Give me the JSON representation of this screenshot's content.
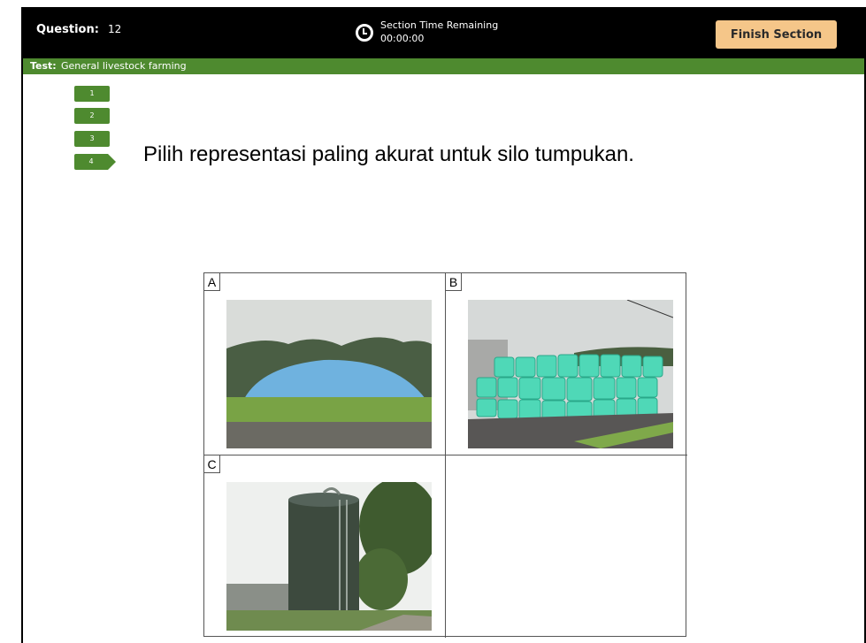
{
  "header": {
    "question_label": "Question:",
    "question_number": "12",
    "timer_label": "Section Time Remaining",
    "timer_value": "00:00:00",
    "finish_button": "Finish Section"
  },
  "test_bar": {
    "label": "Test:",
    "name": "General livestock farming"
  },
  "question_nav": {
    "items": [
      "1",
      "2",
      "3",
      "4"
    ],
    "active": "4"
  },
  "question": {
    "prompt": "Pilih representasi paling akurat untuk silo tumpukan."
  },
  "options": [
    {
      "letter": "A",
      "image": "covered bunker silage pile"
    },
    {
      "letter": "B",
      "image": "wrapped silage bales"
    },
    {
      "letter": "C",
      "image": "tower silo"
    }
  ],
  "colors": {
    "header_bg": "#000000",
    "test_bar_bg": "#4e8a2f",
    "finish_button_bg": "#f5c689"
  }
}
